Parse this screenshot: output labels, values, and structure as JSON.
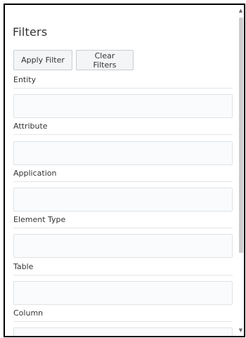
{
  "panel": {
    "title": "Filters",
    "apply_label": "Apply Filter",
    "clear_label": "Clear Filters"
  },
  "fields": [
    {
      "label": "Entity",
      "value": ""
    },
    {
      "label": "Attribute",
      "value": ""
    },
    {
      "label": "Application",
      "value": ""
    },
    {
      "label": "Element Type",
      "value": ""
    },
    {
      "label": "Table",
      "value": ""
    },
    {
      "label": "Column",
      "value": ""
    }
  ],
  "scrollbar": {
    "up_icon": "▲",
    "down_icon": "▼"
  }
}
